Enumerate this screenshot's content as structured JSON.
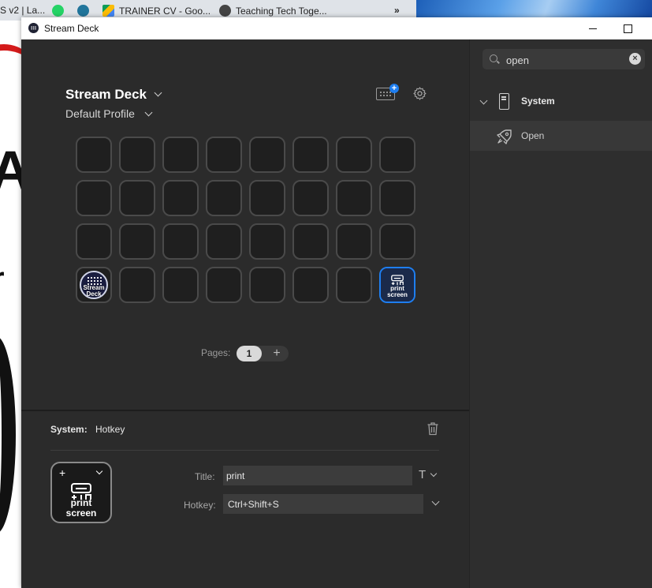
{
  "background": {
    "tabs": [
      {
        "label": "S v2 | La...",
        "icon": "generic-icon"
      },
      {
        "label": "",
        "icon": "whatsapp-icon"
      },
      {
        "label": "",
        "icon": "wordpress-icon"
      },
      {
        "label": "TRAINER CV - Goo...",
        "icon": "google-drive-icon"
      },
      {
        "label": "Teaching Tech Toge...",
        "icon": "globe-icon"
      }
    ],
    "overflow": "»"
  },
  "window": {
    "title": "Stream Deck"
  },
  "device": {
    "name": "Stream Deck",
    "profile": "Default Profile"
  },
  "keys": {
    "streamdeck_label": "Stream\nDeck",
    "printscreen_label": "print\nscreen"
  },
  "pages": {
    "label": "Pages:",
    "current": "1",
    "add": "+"
  },
  "inspector": {
    "category": "System:",
    "action": "Hotkey",
    "key_label": "print\nscreen",
    "title_label": "Title:",
    "title_value": "print",
    "font_icon": "T",
    "hotkey_label": "Hotkey:",
    "hotkey_value": "Ctrl+Shift+S"
  },
  "sidebar": {
    "search_value": "open",
    "category": "System",
    "action": "Open"
  },
  "colors": {
    "accent": "#1e7ef0",
    "background": "#2b2b2b",
    "sidebar": "#2e2e2e"
  }
}
